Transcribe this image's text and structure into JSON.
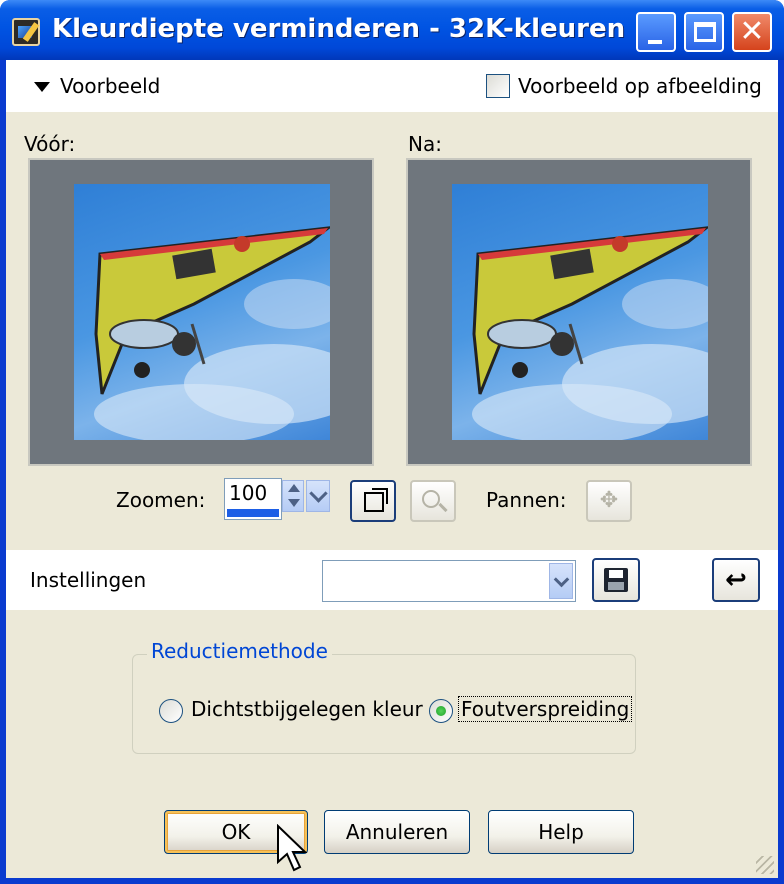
{
  "window": {
    "title": "Kleurdiepte verminderen - 32K-kleuren"
  },
  "preview": {
    "toggle_label": "Voorbeeld",
    "on_image_label": "Voorbeeld op afbeelding",
    "on_image_checked": false,
    "before_label": "Vóór:",
    "after_label": "Na:"
  },
  "zoom": {
    "label": "Zoomen:",
    "value": "100",
    "pan_label": "Pannen:"
  },
  "settings": {
    "label": "Instellingen",
    "value": ""
  },
  "reduction": {
    "group_label": "Reductiemethode",
    "options": [
      {
        "label": "Dichtstbijgelegen kleur",
        "selected": false
      },
      {
        "label": "Foutverspreiding",
        "selected": true
      }
    ]
  },
  "buttons": {
    "ok": "OK",
    "cancel": "Annuleren",
    "help": "Help"
  },
  "icons": {
    "app": "paint-app-icon",
    "minimize": "minimize-icon",
    "maximize": "maximize-icon",
    "close": "close-icon",
    "fit": "fit-to-window-icon",
    "zoom": "zoom-magnifier-icon",
    "pan": "pan-move-icon",
    "save": "floppy-save-icon",
    "reset": "reset-arrow-icon"
  },
  "colors": {
    "titlebar": "#0054e3",
    "face": "#ece9d8",
    "group_title": "#0046d5",
    "close": "#d5431c"
  }
}
